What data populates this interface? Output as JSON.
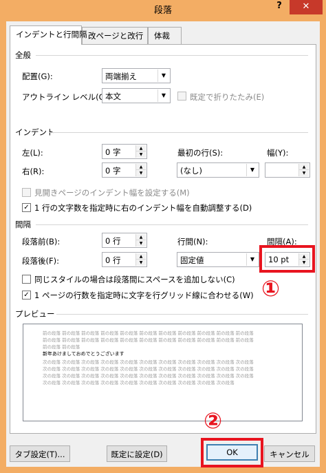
{
  "window": {
    "title": "段落",
    "help": "?",
    "close": "✕"
  },
  "tabs": [
    {
      "label": "インデントと行間隔",
      "active": true
    },
    {
      "label": "改ページと改行",
      "active": false
    },
    {
      "label": "体裁",
      "active": false
    }
  ],
  "general": {
    "heading": "全般",
    "alignment_label": "配置(G):",
    "alignment_value": "両端揃え",
    "outline_label": "アウトライン レベル(O):",
    "outline_value": "本文",
    "collapse_label": "既定で折りたたみ(E)"
  },
  "indent": {
    "heading": "インデント",
    "left_label": "左(L):",
    "left_value": "0 字",
    "right_label": "右(R):",
    "right_value": "0 字",
    "first_line_label": "最初の行(S):",
    "first_line_value": "(なし)",
    "width_label": "幅(Y):",
    "width_value": "",
    "mirror_label": "見開きページのインデント幅を設定する(M)",
    "auto_adjust_label": "1 行の文字数を指定時に右のインデント幅を自動調整する(D)"
  },
  "spacing": {
    "heading": "間隔",
    "before_label": "段落前(B):",
    "before_value": "0 行",
    "after_label": "段落後(F):",
    "after_value": "0 行",
    "line_spacing_label": "行間(N):",
    "line_spacing_value": "固定値",
    "at_label": "間隔(A):",
    "at_value": "10 pt",
    "no_space_label": "同じスタイルの場合は段落間にスペースを追加しない(C)",
    "snap_grid_label": "1 ページの行数を指定時に文字を行グリッド線に合わせる(W)"
  },
  "preview": {
    "heading": "プレビュー",
    "prev_lines": [
      "前の段落 前の段落 前の段落 前の段落 前の段落 前の段落 前の段落 前の段落 前の段落 前の段落 前の段落",
      "前の段落 前の段落 前の段落 前の段落 前の段落 前の段落 前の段落 前の段落 前の段落 前の段落 前の段落",
      "前の段落 前の段落"
    ],
    "current_line": "新年あけましておめでとうございます",
    "next_lines": [
      "次の段落 次の段落 次の段落 次の段落 次の段落 次の段落 次の段落 次の段落 次の段落 次の段落 次の段落",
      "次の段落 次の段落 次の段落 次の段落 次の段落 次の段落 次の段落 次の段落 次の段落 次の段落 次の段落",
      "次の段落 次の段落 次の段落 次の段落 次の段落 次の段落 次の段落 次の段落 次の段落 次の段落 次の段落",
      "次の段落 次の段落 次の段落 次の段落 次の段落 次の段落 次の段落 次の段落 次の段落 次の段落"
    ]
  },
  "buttons": {
    "tabs": "タブ設定(T)...",
    "default": "既定に設定(D)",
    "ok": "OK",
    "cancel": "キャンセル"
  },
  "annotations": {
    "marker_1": "①",
    "marker_2": "②",
    "highlight_color": "#e8141f"
  },
  "checkboxes": {
    "collapse": false,
    "mirror": false,
    "auto_adjust": true,
    "no_space": false,
    "snap_grid": true
  }
}
